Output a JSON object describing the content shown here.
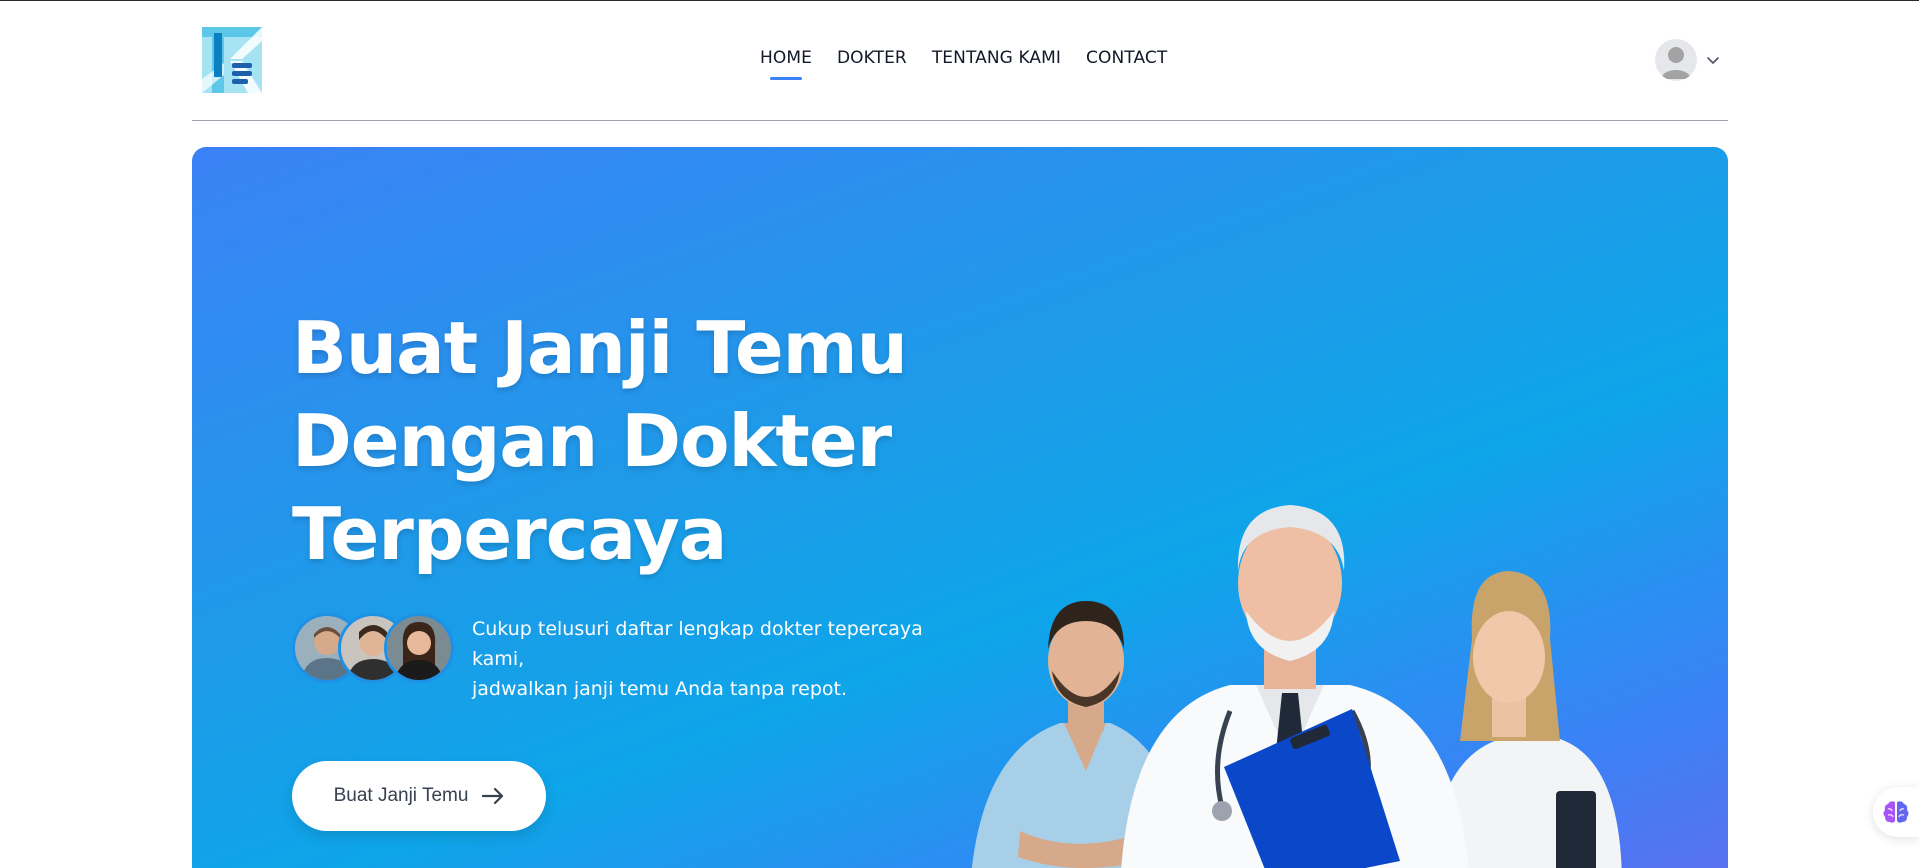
{
  "nav": {
    "items": [
      {
        "label": "HOME",
        "active": true
      },
      {
        "label": "DOKTER",
        "active": false
      },
      {
        "label": "TENTANG KAMI",
        "active": false
      },
      {
        "label": "CONTACT",
        "active": false
      }
    ]
  },
  "user_menu": {
    "avatar_icon": "user-avatar-icon",
    "dropdown_icon": "chevron-down-icon"
  },
  "hero": {
    "title_lines": [
      "Buat Janji Temu",
      "Dengan Dokter",
      "Terpercaya"
    ],
    "description_lines": [
      "Cukup telusuri daftar lengkap dokter tepercaya kami,",
      "jadwalkan janji temu Anda tanpa repot."
    ],
    "cta_label": "Buat Janji Temu",
    "cta_icon": "arrow-right-icon"
  },
  "floating_widget": {
    "icon": "brain-icon"
  },
  "colors": {
    "accent": "#3b82f6",
    "hero_gradient_start": "#3b82f6",
    "hero_gradient_mid": "#0ea5e9",
    "hero_gradient_end": "#5b6ff0",
    "text_dark": "#111827"
  }
}
